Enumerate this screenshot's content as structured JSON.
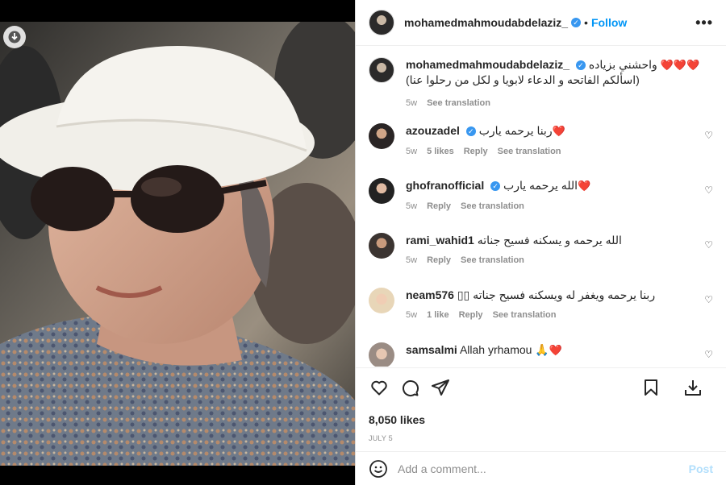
{
  "post": {
    "username": "mohamedmahmoudabdelaziz_",
    "follow_label": "Follow",
    "more_label": "•••",
    "photo_alt": "",
    "caption_line1": "واحشني بزياده",
    "caption_hearts": "❤️❤️❤️",
    "caption_line2": "(اسألكم الفاتحه و الدعاء لابويا و لكل من رحلوا عنا)",
    "caption_time": "5w",
    "see_translation": "See translation"
  },
  "comments": [
    {
      "username": "azouzadel",
      "verified": true,
      "text": "ربنا يرحمه يارب",
      "hearts": "❤️",
      "time": "5w",
      "likes": "5 likes",
      "reply": "Reply",
      "translate": "See translation"
    },
    {
      "username": "ghofranofficial",
      "verified": true,
      "text": "الله يرحمه يارب",
      "hearts": "❤️",
      "time": "5w",
      "likes": "",
      "reply": "Reply",
      "translate": "See translation"
    },
    {
      "username": "rami_wahid1",
      "verified": false,
      "text": "الله يرحمه و يسكنه فسيح جناته",
      "hearts": "",
      "time": "5w",
      "likes": "",
      "reply": "Reply",
      "translate": "See translation"
    },
    {
      "username": "neam576",
      "verified": false,
      "text": "ربنا يرحمه ويغفر له ويسكنه فسيح جناته ▯▯",
      "hearts": "",
      "time": "5w",
      "likes": "1 like",
      "reply": "Reply",
      "translate": "See translation"
    },
    {
      "username": "samsalmi",
      "verified": false,
      "text": "Allah yrhamou 🙏",
      "hearts": "❤️",
      "time": "",
      "likes": "",
      "reply": "",
      "translate": ""
    }
  ],
  "actions": {
    "likes": "8,050 likes",
    "date": "JULY 5"
  },
  "add_comment": {
    "placeholder": "Add a comment...",
    "post_label": "Post"
  },
  "colors": {
    "accent": "#0095f6",
    "heart": "#ed4956",
    "muted": "#8e8e8e",
    "text": "#262626"
  },
  "icons": [
    "download-icon",
    "verified-icon",
    "more-icon",
    "heart-icon",
    "comment-icon",
    "share-icon",
    "bookmark-icon",
    "emoji-icon"
  ]
}
